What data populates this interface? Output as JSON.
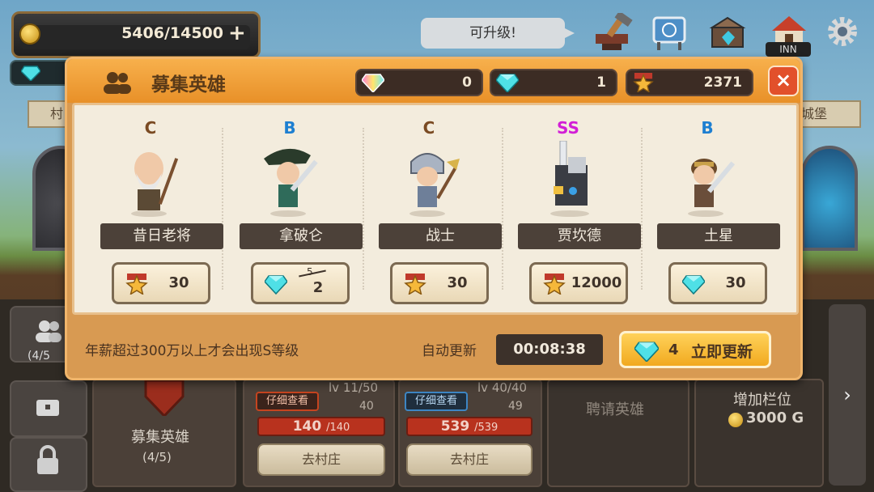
{
  "topbar": {
    "gold": "5406/14500",
    "plus_label": "+",
    "upgrade_bubble": "可升级!",
    "inn_label": "INN"
  },
  "scene": {
    "banner_left": "村",
    "banner_right": "城堡"
  },
  "bottom": {
    "side_count": "(4/5",
    "recruit_card_title": "募集英雄",
    "recruit_card_count": "(4/5)",
    "hero_cards": [
      {
        "detail": "仔细查看",
        "level": "lv 11/50",
        "attack": "40",
        "hp": "140",
        "hp_max": "/140",
        "go": "去村庄"
      },
      {
        "detail": "仔细查看",
        "level": "lv 40/40",
        "attack": "49",
        "hp": "539",
        "hp_max": "/539",
        "go": "去村庄"
      }
    ],
    "hire_label": "聘请英雄",
    "add_slot_label": "增加栏位",
    "add_slot_cost": "3000 G",
    "next_arrow": "›"
  },
  "modal": {
    "title": "募集英雄",
    "currencies": [
      {
        "icon": "rainbow-gem-icon",
        "value": "0"
      },
      {
        "icon": "diamond-icon",
        "value": "1"
      },
      {
        "icon": "star-icon",
        "value": "2371"
      }
    ],
    "close_label": "×",
    "heroes": [
      {
        "grade": "C",
        "grade_color": "#7a4a22",
        "name": "昔日老将",
        "price_icon": "star-icon",
        "price": "30",
        "old_price": ""
      },
      {
        "grade": "B",
        "grade_color": "#1d7fd1",
        "name": "拿破仑",
        "price_icon": "diamond-icon",
        "price": "2",
        "old_price": "5"
      },
      {
        "grade": "C",
        "grade_color": "#7a4a22",
        "name": "战士",
        "price_icon": "star-icon",
        "price": "30",
        "old_price": ""
      },
      {
        "grade": "SS",
        "grade_color": "#d21fd6",
        "name": "贾坎德",
        "price_icon": "star-icon",
        "price": "12000",
        "old_price": ""
      },
      {
        "grade": "B",
        "grade_color": "#1d7fd1",
        "name": "土星",
        "price_icon": "diamond-icon",
        "price": "30",
        "old_price": ""
      }
    ],
    "footer_note": "年薪超过300万以上才会出现S等级",
    "auto_refresh_label": "自动更新",
    "timer": "00:08:38",
    "refresh_cost": "4",
    "refresh_label": "立即更新"
  }
}
